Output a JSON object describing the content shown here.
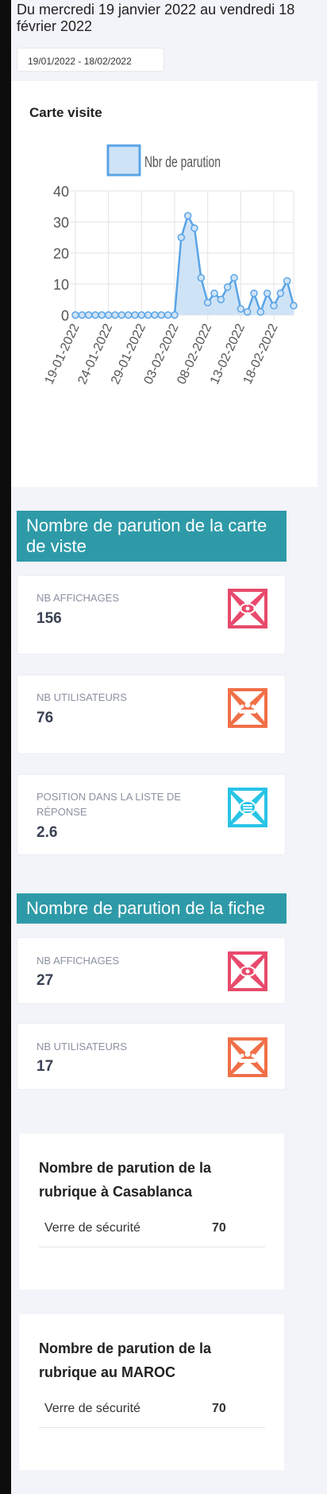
{
  "header": {
    "period_text": "Du mercredi 19 janvier 2022 au vendredi 18 février 2022",
    "date_range_value": "19/01/2022 - 18/02/2022"
  },
  "chart_card": {
    "title": "Carte visite"
  },
  "chart_data": {
    "type": "area",
    "legend": "Nbr de parution",
    "x_tick_labels": [
      "19-01-2022",
      "24-01-2022",
      "29-01-2022",
      "03-02-2022",
      "08-02-2022",
      "13-02-2022",
      "18-02-2022"
    ],
    "y_tick_labels": [
      "40",
      "30",
      "20",
      "10",
      "0"
    ],
    "ylim": [
      0,
      40
    ],
    "x_start": "2022-01-19",
    "x_end": "2022-02-18",
    "values": [
      0,
      0,
      0,
      0,
      0,
      0,
      0,
      0,
      0,
      0,
      0,
      0,
      0,
      0,
      0,
      0,
      25,
      32,
      28,
      12,
      4,
      7,
      5,
      9,
      12,
      2,
      1,
      7,
      1,
      7,
      3,
      7,
      11,
      3
    ],
    "grid": true,
    "legend_placement": "top",
    "colors": {
      "line": "#59a4e6",
      "fill": "#cfe3f7"
    }
  },
  "section1": {
    "banner": "Nombre de parution de la carte de viste",
    "cards": [
      {
        "label": "NB AFFICHAGES",
        "value": "156",
        "icon": "eye-icon",
        "color": "#e84a6c"
      },
      {
        "label": "NB UTILISATEURS",
        "value": "76",
        "icon": "users-icon",
        "color": "#f07048"
      },
      {
        "label": "POSITION DANS LA LISTE DE RÉPONSE",
        "value": "2.6",
        "icon": "list-icon",
        "color": "#28c4e6"
      }
    ]
  },
  "section2": {
    "banner": "Nombre de parution de la fiche",
    "cards": [
      {
        "label": "NB AFFICHAGES",
        "value": "27",
        "icon": "eye-icon",
        "color": "#e84a6c"
      },
      {
        "label": "NB UTILISATEURS",
        "value": "17",
        "icon": "users-icon",
        "color": "#f07048"
      }
    ]
  },
  "rubric_casablanca": {
    "title": "Nombre de parution de la rubrique à Casablanca",
    "rows": [
      {
        "name": "Verre de sécurité",
        "value": "70"
      }
    ]
  },
  "rubric_maroc": {
    "title": "Nombre de parution de la rubrique au MAROC",
    "rows": [
      {
        "name": "Verre de sécurité",
        "value": "70"
      }
    ]
  }
}
